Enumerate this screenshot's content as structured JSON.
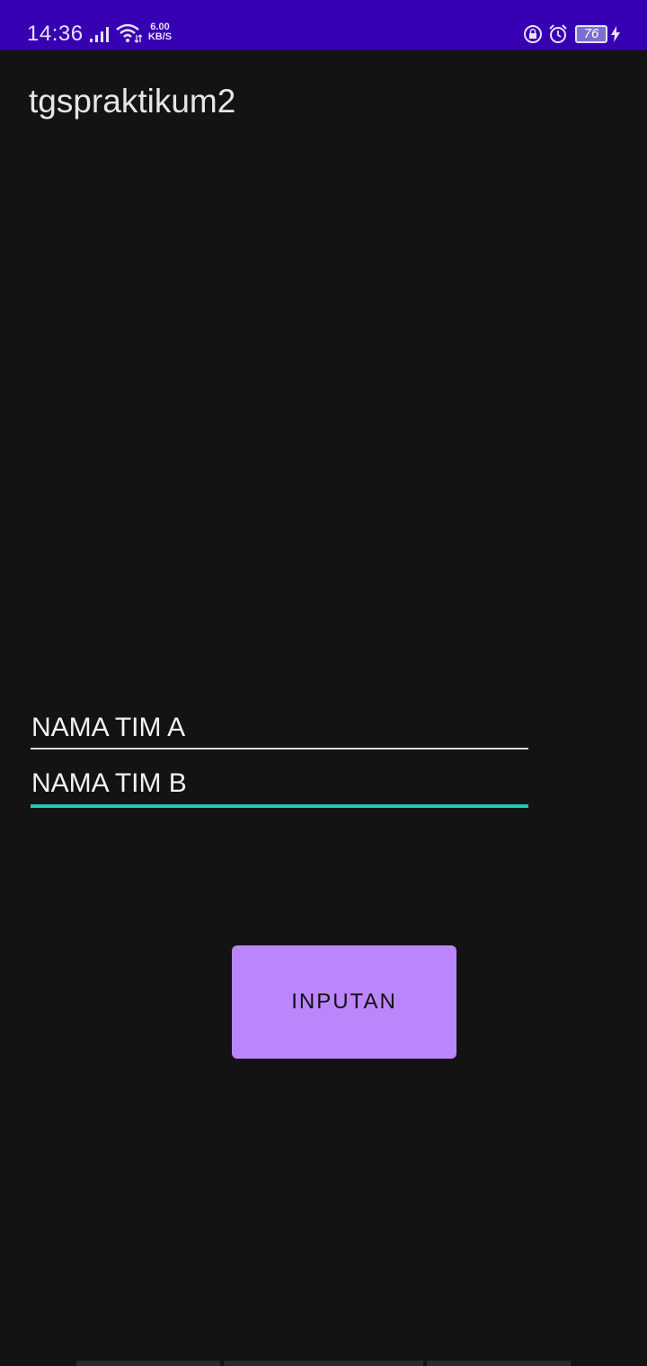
{
  "status_bar": {
    "time": "14:36",
    "net_speed_value": "6.00",
    "net_speed_unit": "KB/S",
    "battery_level": "76",
    "background_color": "#3700b3",
    "icons": [
      "signal-icon",
      "wifi-icon",
      "lock-rotate-icon",
      "alarm-icon",
      "battery-icon",
      "charging-icon"
    ]
  },
  "app_bar": {
    "title": "tgspraktikum2"
  },
  "form": {
    "team_a_placeholder": "NAMA TIM A",
    "team_b_placeholder": "NAMA TIM B",
    "focused_field": "team_b",
    "focus_color": "#1dc8b5"
  },
  "actions": {
    "submit_label": "INPUTAN",
    "button_color": "#bb86fc"
  }
}
